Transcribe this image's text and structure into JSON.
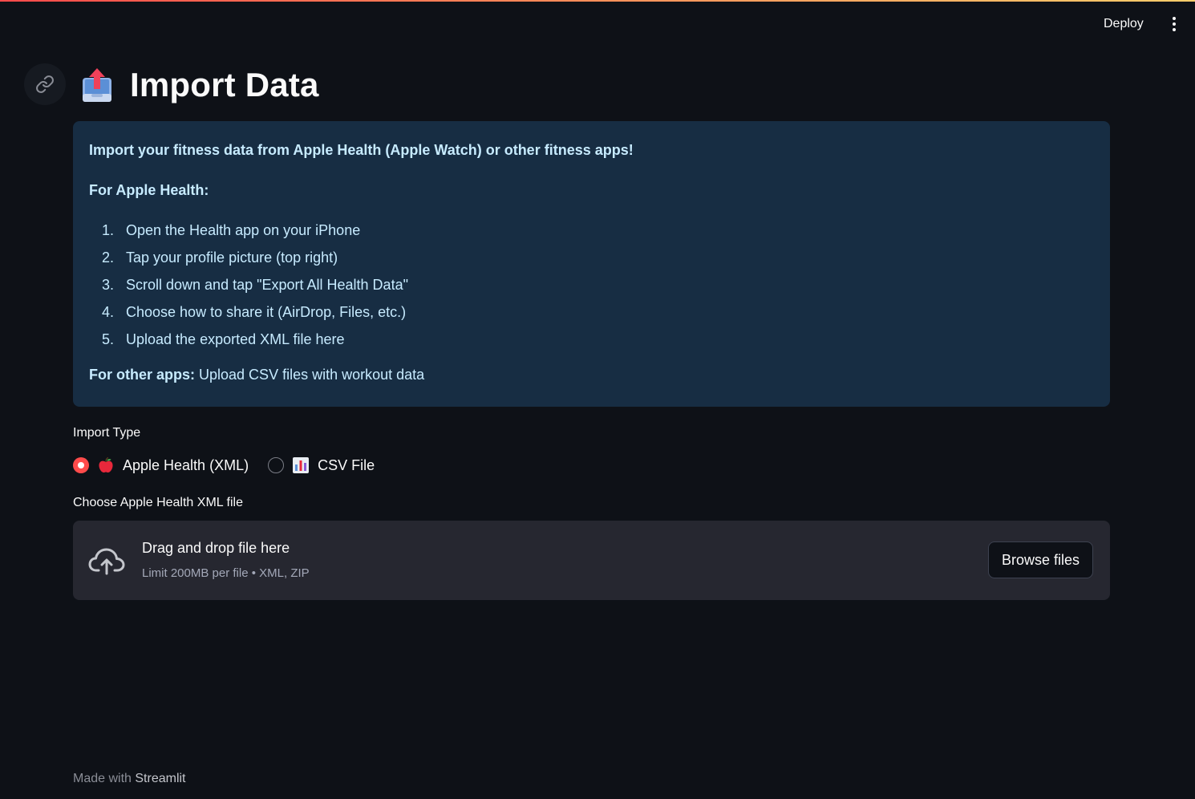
{
  "header": {
    "deploy_label": "Deploy",
    "accent_gradient": [
      "#ff4b4b",
      "#fdcd6b"
    ]
  },
  "page": {
    "title": "Import Data",
    "title_icon": "outbox-tray-icon"
  },
  "info": {
    "intro": "Import your fitness data from Apple Health (Apple Watch) or other fitness apps!",
    "apple_heading": "For Apple Health:",
    "steps": [
      "Open the Health app on your iPhone",
      "Tap your profile picture (top right)",
      "Scroll down and tap \"Export All Health Data\"",
      "Choose how to share it (AirDrop, Files, etc.)",
      "Upload the exported XML file here"
    ],
    "other_label": "For other apps:",
    "other_text": " Upload CSV files with workout data",
    "background": "#172d43",
    "text_color": "#c7ebff"
  },
  "import_type": {
    "label": "Import Type",
    "options": [
      {
        "label": "Apple Health (XML)",
        "icon": "red-apple-icon",
        "selected": true
      },
      {
        "label": "CSV File",
        "icon": "bar-chart-icon",
        "selected": false
      }
    ],
    "accent": "#ff4b4b"
  },
  "uploader": {
    "label": "Choose Apple Health XML file",
    "title": "Drag and drop file here",
    "limit": "Limit 200MB per file • XML, ZIP",
    "browse_label": "Browse files",
    "icon": "cloud-upload-icon"
  },
  "footer": {
    "prefix": "Made with ",
    "brand": "Streamlit"
  }
}
